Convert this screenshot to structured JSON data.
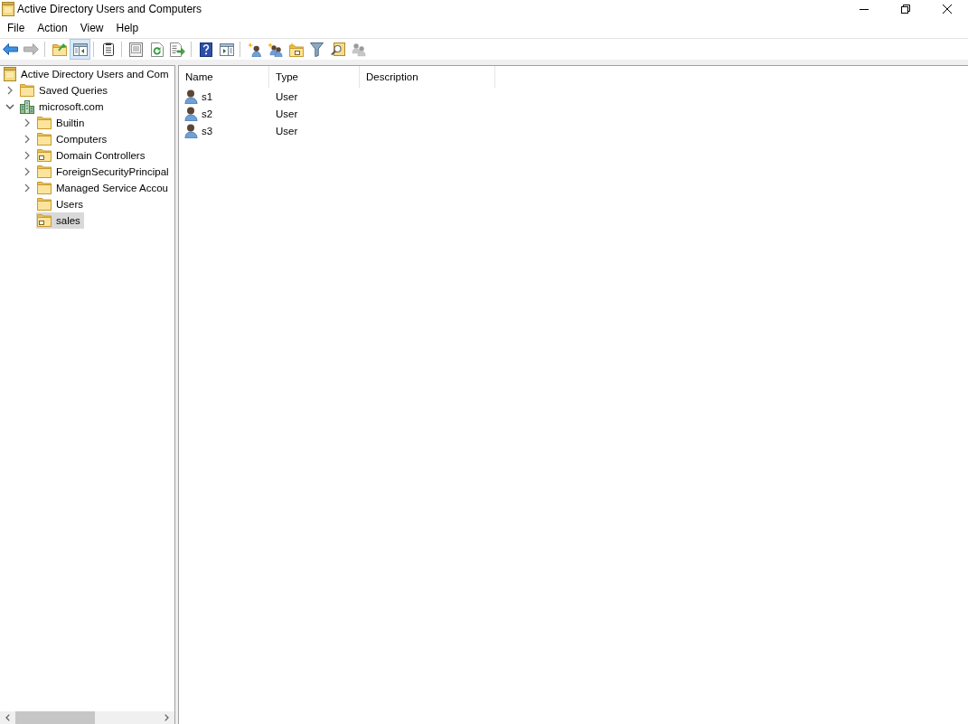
{
  "window": {
    "title": "Active Directory Users and Computers"
  },
  "menu": [
    {
      "label": "File"
    },
    {
      "label": "Action"
    },
    {
      "label": "View"
    },
    {
      "label": "Help"
    }
  ],
  "toolbar": {
    "groups": [
      {
        "buttons": [
          {
            "pressed": false,
            "disabled": false
          },
          {
            "pressed": false,
            "disabled": true
          }
        ]
      },
      {
        "buttons": [
          {
            "pressed": false,
            "disabled": false
          },
          {
            "pressed": true,
            "disabled": false
          }
        ]
      },
      {
        "buttons": [
          {
            "pressed": false,
            "disabled": false
          }
        ]
      },
      {
        "buttons": [
          {
            "pressed": false,
            "disabled": false
          },
          {
            "pressed": false,
            "disabled": false
          },
          {
            "pressed": false,
            "disabled": false
          }
        ]
      },
      {
        "buttons": [
          {
            "pressed": false,
            "disabled": false
          },
          {
            "pressed": false,
            "disabled": false
          }
        ]
      },
      {
        "buttons": [
          {
            "pressed": false,
            "disabled": false
          },
          {
            "pressed": false,
            "disabled": false
          },
          {
            "pressed": false,
            "disabled": false
          },
          {
            "pressed": false,
            "disabled": false
          },
          {
            "pressed": false,
            "disabled": false
          },
          {
            "pressed": false,
            "disabled": true
          }
        ]
      }
    ]
  },
  "tree": [
    {
      "label": "Active Directory Users and Com",
      "kind": "root",
      "selected": false,
      "children": [
        {
          "label": "Saved Queries",
          "kind": "folder",
          "expanded": false,
          "selected": false
        },
        {
          "label": "microsoft.com",
          "kind": "domain",
          "expanded": true,
          "selected": false,
          "children": [
            {
              "label": "Builtin",
              "kind": "folder",
              "expanded": false,
              "selected": false
            },
            {
              "label": "Computers",
              "kind": "folder",
              "expanded": false,
              "selected": false
            },
            {
              "label": "Domain Controllers",
              "kind": "ou",
              "expanded": false,
              "selected": false
            },
            {
              "label": "ForeignSecurityPrincipal",
              "kind": "folder",
              "expanded": false,
              "selected": false
            },
            {
              "label": "Managed Service Accou",
              "kind": "folder",
              "expanded": false,
              "selected": false
            },
            {
              "label": "Users",
              "kind": "folder",
              "selected": false
            },
            {
              "label": "sales",
              "kind": "ou",
              "selected": true
            }
          ]
        }
      ]
    }
  ],
  "list": {
    "columns": [
      {
        "label": "Name"
      },
      {
        "label": "Type"
      },
      {
        "label": "Description"
      }
    ],
    "rows": [
      {
        "name": "s1",
        "type": "User",
        "kind": "user",
        "selected": false
      },
      {
        "name": "s2",
        "type": "User",
        "kind": "user",
        "selected": false
      },
      {
        "name": "s3",
        "type": "User",
        "kind": "user",
        "selected": false
      }
    ]
  }
}
